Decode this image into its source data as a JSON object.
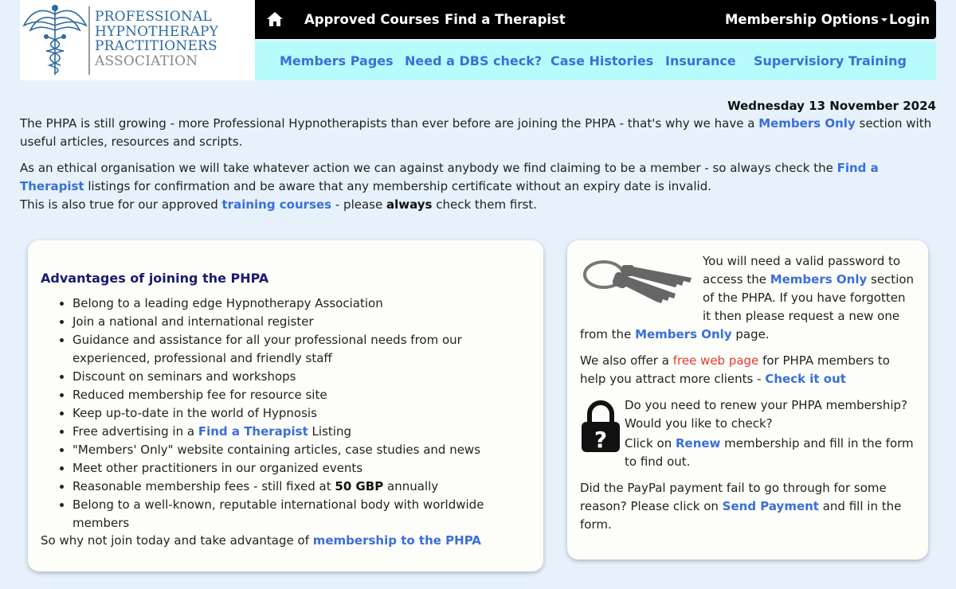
{
  "logo": {
    "line1": "PROFESSIONAL",
    "line2": "HYPNOTHERAPY",
    "line3": "PRACTITIONERS",
    "line4": "ASSOCIATION",
    "icon": "caduceus-icon"
  },
  "topnav": {
    "home_icon": "home-icon",
    "approved_courses": "Approved Courses",
    "find_therapist": "Find a Therapist",
    "membership_options": "Membership Options",
    "login": "Login"
  },
  "subnav": {
    "members_pages": "Members Pages",
    "dbs_check": "Need a DBS check?",
    "case_histories": "Case Histories",
    "insurance": "Insurance",
    "supervisory_training": "Supervisiory Training"
  },
  "date": "Wednesday 13 November 2024",
  "intro": {
    "p1_a": "The PHPA is still growing - more Professional Hypnotherapists than ever before are joining the PHPA - that's why we have a ",
    "p1_link": "Members Only",
    "p1_b": " section with useful articles, resources and scripts.",
    "p2_a": "As an ethical organisation we will take whatever action we can against anybody we find claiming to be a member - so always check the ",
    "p2_link": "Find a Therapist",
    "p2_b": " listings for confirmation and be aware that any membership certificate without an expiry date is invalid.",
    "p3_a": "This is also true for our approved ",
    "p3_link": "training courses",
    "p3_b": " - please ",
    "p3_bold": "always",
    "p3_c": " check them first."
  },
  "advantages": {
    "title": "Advantages of joining the PHPA",
    "items": [
      "Belong to a leading edge Hypnotherapy Association",
      "Join a national and international register",
      "Guidance and assistance for all your professional needs from our experienced, professional and friendly staff",
      "Discount on seminars and workshops",
      "Reduced membership fee for resource site",
      "Keep up-to-date in the world of Hypnosis"
    ],
    "item7_a": "Free advertising in a ",
    "item7_link": "Find a Therapist",
    "item7_b": " Listing",
    "item8": "\"Members' Only\" website containing articles, case studies and news",
    "item9": "Meet other practitioners in our organized events",
    "item10_a": "Reasonable membership fees - still fixed at ",
    "item10_bold": "50 GBP",
    "item10_b": " annually",
    "item11": "Belong to a well-known, reputable international body with worldwide members",
    "closing_a": "So why not join today and take advantage of ",
    "closing_link": "membership to the PHPA"
  },
  "side": {
    "keys_icon": "keys-icon",
    "pw_a": "You will need a valid password to access the ",
    "pw_link": "Members Only",
    "pw_b": " section of the PHPA. If you have forgotten it then please request a new one from the ",
    "pw_link2": "Members Only",
    "pw_c": " page.",
    "web_a": "We also offer a ",
    "web_red": "free web page",
    "web_b": " for PHPA members to help you attract more clients - ",
    "web_link": "Check it out",
    "lock_icon": "padlock-question-icon",
    "renew_a": "Do you need to renew your PHPA membership? Would you like to check?",
    "renew_b": "Click on ",
    "renew_link": "Renew",
    "renew_c": " membership and fill in the form to find out.",
    "pay_a": "Did the PayPal payment fail to go through for some reason? Please click on ",
    "pay_link": "Send Payment",
    "pay_b": " and fill in the form."
  }
}
